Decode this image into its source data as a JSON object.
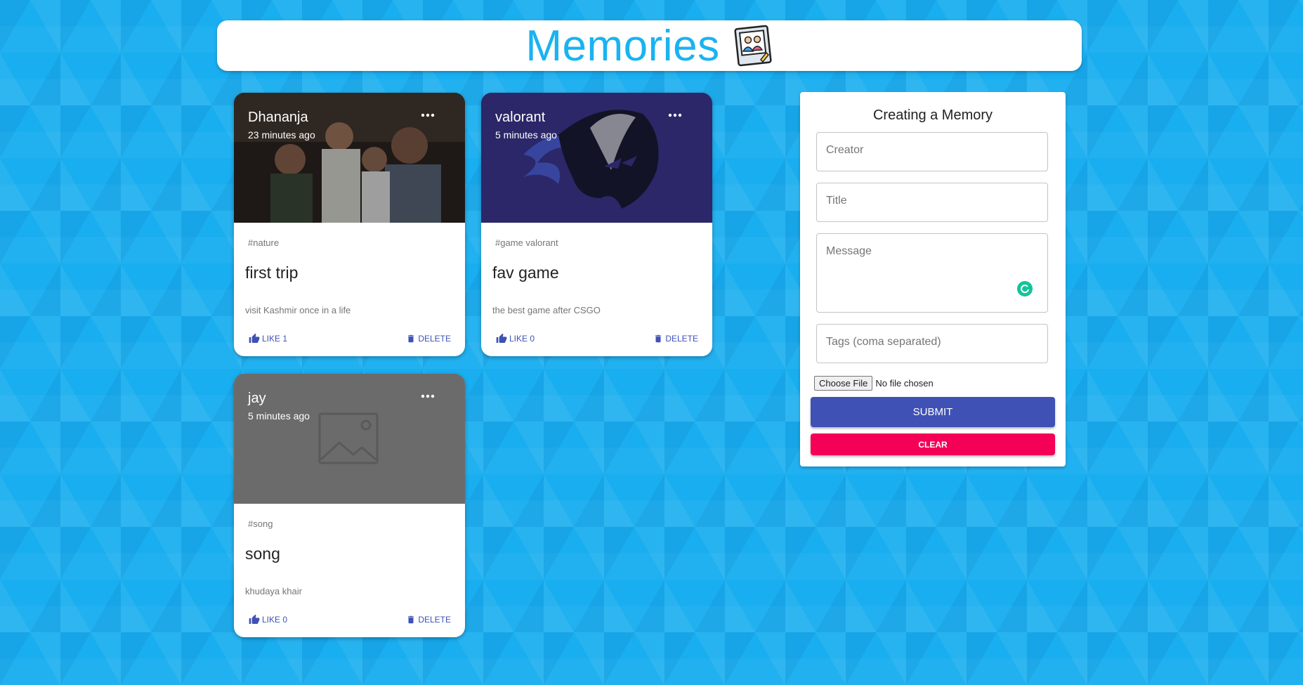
{
  "app": {
    "title": "Memories",
    "logo_icon": "photo-album-icon"
  },
  "posts": [
    {
      "creator": "Dhananja",
      "time": "23 minutes ago",
      "tags": "#nature",
      "title": "first trip",
      "message": "visit Kashmir once in a life",
      "like_label": "LIKE 1",
      "delete_label": "DELETE",
      "media": "group selfie photo"
    },
    {
      "creator": "valorant",
      "time": "5 minutes ago",
      "tags": "#game valorant",
      "title": "fav game",
      "message": "the best game after CSGO",
      "like_label": "LIKE 0",
      "delete_label": "DELETE",
      "media": "hooded character logo"
    },
    {
      "creator": "jay",
      "time": "5 minutes ago",
      "tags": "#song",
      "title": "song",
      "message": "khudaya khair",
      "like_label": "LIKE 0",
      "delete_label": "DELETE",
      "media": "image placeholder"
    }
  ],
  "form": {
    "heading": "Creating a Memory",
    "creator_placeholder": "Creator",
    "title_placeholder": "Title",
    "message_placeholder": "Message",
    "tags_placeholder": "Tags (coma separated)",
    "file_button": "Choose File",
    "file_status": "No file chosen",
    "submit_label": "SUBMIT",
    "clear_label": "CLEAR"
  },
  "colors": {
    "primary": "#3f51b5",
    "secondary": "#f50057",
    "title": "#1ab3f0",
    "background": "#19aeef"
  }
}
